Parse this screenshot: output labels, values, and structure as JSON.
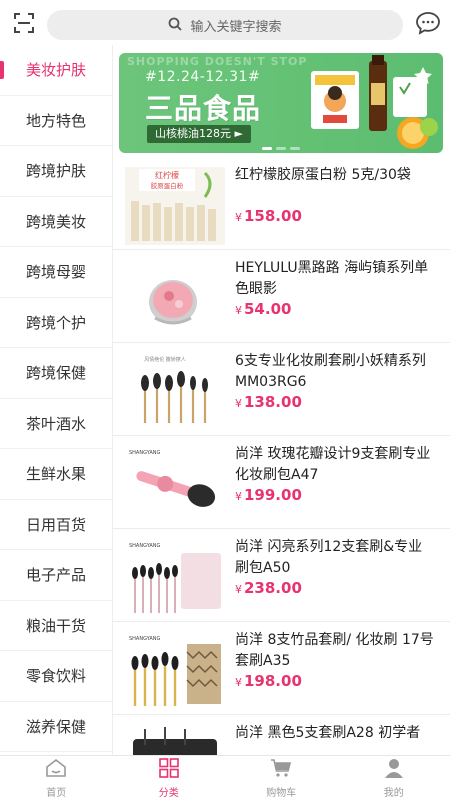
{
  "colors": {
    "accent": "#e8336e",
    "banner_green": "#63c174",
    "tab_inactive": "#999999"
  },
  "header": {
    "scan_icon": "scan-icon",
    "search": {
      "placeholder": "输入关键字搜索",
      "icon": "search-icon"
    },
    "message_icon": "chat-bubble-icon"
  },
  "sidebar": {
    "items": [
      {
        "label": "美妆护肤",
        "active": true
      },
      {
        "label": "地方特色"
      },
      {
        "label": "跨境护肤"
      },
      {
        "label": "跨境美妆"
      },
      {
        "label": "跨境母婴"
      },
      {
        "label": "跨境个护"
      },
      {
        "label": "跨境保健"
      },
      {
        "label": "茶叶酒水"
      },
      {
        "label": "生鲜水果"
      },
      {
        "label": "日用百货"
      },
      {
        "label": "电子产品"
      },
      {
        "label": "粮油干货"
      },
      {
        "label": "零食饮料"
      },
      {
        "label": "滋养保健"
      }
    ]
  },
  "banner": {
    "faint_text": "SHOPPING DOESN'T STOP",
    "date": "#12.24-12.31#",
    "title": "三品食品",
    "chip": "山核桃油128元 ►"
  },
  "products": [
    {
      "name": "红柠檬胶原蛋白粉 5克/30袋",
      "price": "158.00",
      "currency": "¥"
    },
    {
      "name": "HEYLULU黑路路 海屿镇系列单色眼影",
      "price": "54.00",
      "currency": "¥"
    },
    {
      "name": "6支专业化妆刷套刷小妖精系列MM03RG6",
      "price": "138.00",
      "currency": "¥"
    },
    {
      "name": "尚洋 玫瑰花瓣设计9支套刷专业化妆刷包A47",
      "price": "199.00",
      "currency": "¥"
    },
    {
      "name": "尚洋 闪亮系列12支套刷&专业刷包A50",
      "price": "238.00",
      "currency": "¥"
    },
    {
      "name": "尚洋 8支竹品套刷/ 化妆刷 17号套刷A35",
      "price": "198.00",
      "currency": "¥"
    },
    {
      "name": "尚洋 黑色5支套刷A28 初学者",
      "price": "",
      "currency": ""
    }
  ],
  "tabbar": {
    "items": [
      {
        "label": "首页",
        "icon": "home-icon"
      },
      {
        "label": "分类",
        "icon": "category-grid-icon",
        "active": true
      },
      {
        "label": "购物车",
        "icon": "cart-icon"
      },
      {
        "label": "我的",
        "icon": "user-icon"
      }
    ]
  }
}
